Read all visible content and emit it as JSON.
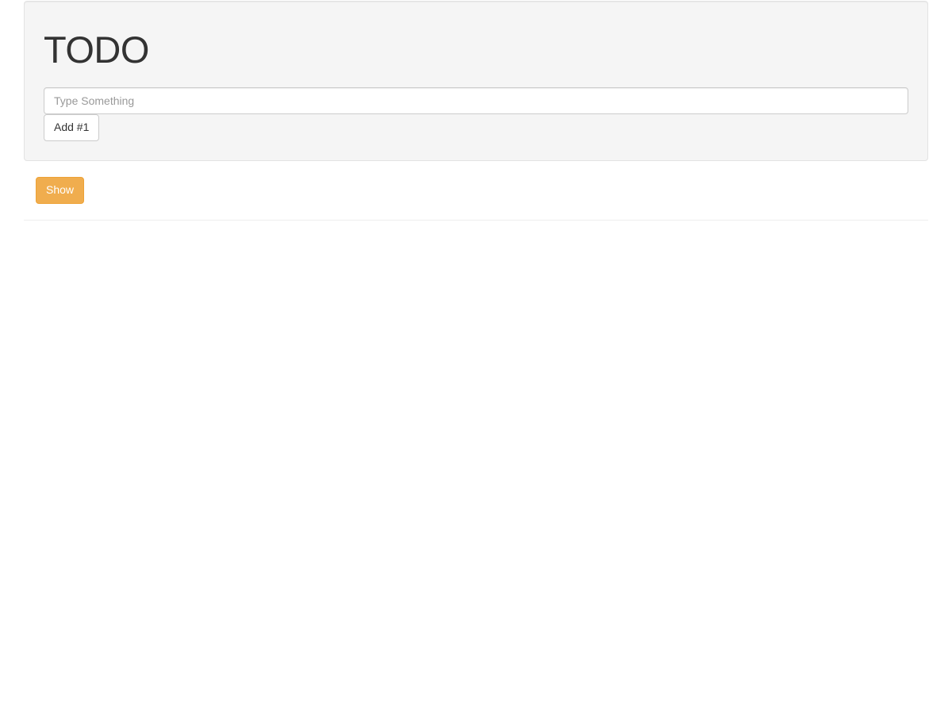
{
  "panel": {
    "title": "TODO",
    "input_placeholder": "Type Something",
    "input_value": "",
    "add_button_label": "Add #1"
  },
  "actions": {
    "show_button_label": "Show"
  },
  "colors": {
    "warning_bg": "#f0ad4e",
    "well_bg": "#f5f5f5"
  }
}
